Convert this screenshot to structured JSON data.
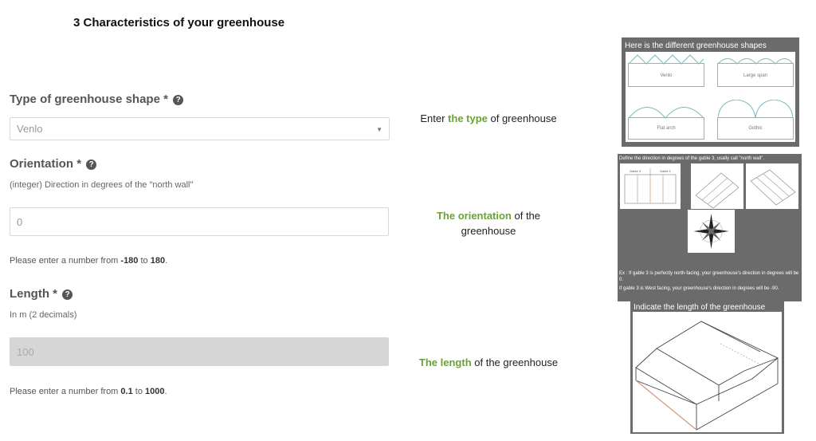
{
  "page_title": "3 Characteristics of your greenhouse",
  "shape_field": {
    "label": "Type of greenhouse shape",
    "required_mark": "*",
    "value": "Venlo",
    "description": {
      "prefix": "Enter ",
      "highlight": "the type",
      "suffix": " of greenhouse"
    }
  },
  "orientation_field": {
    "label": "Orientation",
    "required_mark": "*",
    "sublabel": "(integer) Direction in degrees of the \"north wall\"",
    "placeholder": "0",
    "hint_prefix": "Please enter a number from ",
    "hint_min": "-180",
    "hint_mid": " to ",
    "hint_max": "180",
    "hint_suffix": ".",
    "description": {
      "highlight": "The orientation",
      "suffix": " of the",
      "line2": "greenhouse"
    }
  },
  "length_field": {
    "label": "Length",
    "required_mark": "*",
    "sublabel": "In m (2 decimals)",
    "placeholder": "100",
    "hint_prefix": "Please enter a number from ",
    "hint_min": "0.1",
    "hint_mid": " to ",
    "hint_max": "1000",
    "hint_suffix": ".",
    "description": {
      "highlight": "The length",
      "suffix": " of the greenhouse"
    }
  },
  "shapes_panel": {
    "title": "Here is the different greenhouse shapes",
    "shapes": [
      "Venlo",
      "Large span",
      "Flat arch",
      "Gothic"
    ]
  },
  "orientation_panel": {
    "title": "Define the direction in degrees of the gable 3, usally call \"north wall\".",
    "gable_labels": [
      "Gable 3",
      "Gable 1"
    ],
    "example_1": "Ex : If gable 3 is perfectly north-facing, your greenhouse's direction in degrees will be 0.",
    "example_2": "If gable 3 is West facing, your greenhouse's direction in degrees will be -90."
  },
  "length_panel": {
    "title": "Indicate the length of the greenhouse"
  },
  "colors": {
    "accent_green": "#6aa13a",
    "panel_gray": "#6b6b6b",
    "help_icon": "#555555"
  },
  "icons": {
    "help": "question-circle-icon",
    "select_arrow": "chevron-down-icon",
    "compass": "compass-rose-icon"
  }
}
